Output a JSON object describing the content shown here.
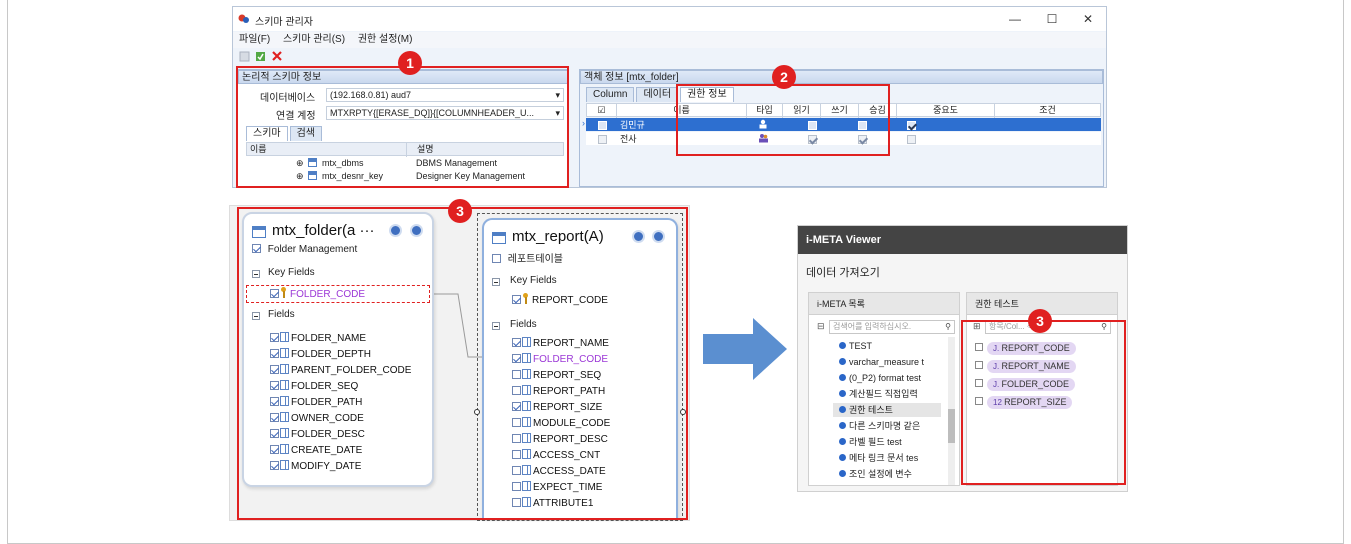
{
  "window": {
    "title": "스키마 관리자",
    "controls": {
      "minimize": "—",
      "maximize": "☐",
      "close": "✕"
    },
    "menu": [
      "파일(F)",
      "스키마 관리(S)",
      "권한 설정(M)"
    ],
    "toolbar_icons": [
      "new-icon",
      "refresh-icon",
      "delete-icon"
    ]
  },
  "left_panel": {
    "title": "논리적 스키마 정보",
    "database_label": "데이터베이스",
    "database_value": "(192.168.0.81) aud7",
    "account_label": "연결 계정",
    "account_value": "MTXRPTY{[ERASE_DQ]}{[COLUMNHEADER_U...",
    "tabs": [
      "스키마",
      "검색"
    ],
    "grid_headers": [
      "이름",
      "설명"
    ],
    "rows": [
      {
        "name": "mtx_dbms",
        "desc": "DBMS Management"
      },
      {
        "name": "mtx_desnr_key",
        "desc": "Designer Key Management"
      }
    ]
  },
  "right_panel": {
    "title": "객체 정보 [mtx_folder]",
    "tabs": [
      "Column",
      "데이터",
      "권한 정보"
    ],
    "grid_headers": [
      "☑",
      "이름",
      "타입",
      "읽기",
      "쓰기",
      "승김",
      "중요도",
      "조건"
    ],
    "rows": [
      {
        "name": "김민규",
        "read": false,
        "write": false,
        "hide": true,
        "selected": true
      },
      {
        "name": "전사",
        "read": true,
        "write": true,
        "hide": false,
        "selected": false
      }
    ]
  },
  "badges": [
    "1",
    "2",
    "3",
    "3"
  ],
  "folder_card": {
    "title": "mtx_folder(a ···",
    "description": "Folder Management",
    "key_section": "Key Fields",
    "key_fields": [
      "FOLDER_CODE"
    ],
    "fields_section": "Fields",
    "fields": [
      "FOLDER_NAME",
      "FOLDER_DEPTH",
      "PARENT_FOLDER_CODE",
      "FOLDER_SEQ",
      "FOLDER_PATH",
      "OWNER_CODE",
      "FOLDER_DESC",
      "CREATE_DATE",
      "MODIFY_DATE"
    ]
  },
  "report_card": {
    "title": "mtx_report(A)",
    "description": "레포트테이블",
    "key_section": "Key Fields",
    "key_fields": [
      "REPORT_CODE"
    ],
    "fields_section": "Fields",
    "fields": [
      {
        "name": "REPORT_NAME",
        "checked": true,
        "highlight": false
      },
      {
        "name": "FOLDER_CODE",
        "checked": true,
        "highlight": true
      },
      {
        "name": "REPORT_SEQ",
        "checked": false,
        "highlight": false
      },
      {
        "name": "REPORT_PATH",
        "checked": false,
        "highlight": false
      },
      {
        "name": "REPORT_SIZE",
        "checked": true,
        "highlight": false
      },
      {
        "name": "MODULE_CODE",
        "checked": false,
        "highlight": false
      },
      {
        "name": "REPORT_DESC",
        "checked": false,
        "highlight": false
      },
      {
        "name": "ACCESS_CNT",
        "checked": false,
        "highlight": false
      },
      {
        "name": "ACCESS_DATE",
        "checked": false,
        "highlight": false
      },
      {
        "name": "EXPECT_TIME",
        "checked": false,
        "highlight": false
      },
      {
        "name": "ATTRIBUTE1",
        "checked": false,
        "highlight": false
      }
    ]
  },
  "viewer": {
    "title": "i-META Viewer",
    "subtitle": "데이터 가져오기",
    "list_panel_title": "i-META 목록",
    "list_search_placeholder": "검색어를 입력하십시오.",
    "list_items": [
      "TEST",
      "varchar_measure t",
      "(0_P2) format test",
      "계산필드 직접입력",
      "권한 테스트",
      "다른 스키마명 같은",
      "라벨 필드 test",
      "메타 링크 문서 tes",
      "조인 설정에 변수"
    ],
    "selected_item": "권한 테스트",
    "right_panel_title": "권한 테스트",
    "right_search_placeholder": "항목/Col... 색",
    "columns": [
      {
        "name": "REPORT_CODE",
        "kind": "text"
      },
      {
        "name": "REPORT_NAME",
        "kind": "text"
      },
      {
        "name": "FOLDER_CODE",
        "kind": "text"
      },
      {
        "name": "REPORT_SIZE",
        "kind": "number"
      }
    ]
  },
  "colors": {
    "accent_red": "#e02020",
    "arrow_blue": "#5b8fd0",
    "selection_blue": "#2d6fd0",
    "purple": "#9b37d6"
  }
}
